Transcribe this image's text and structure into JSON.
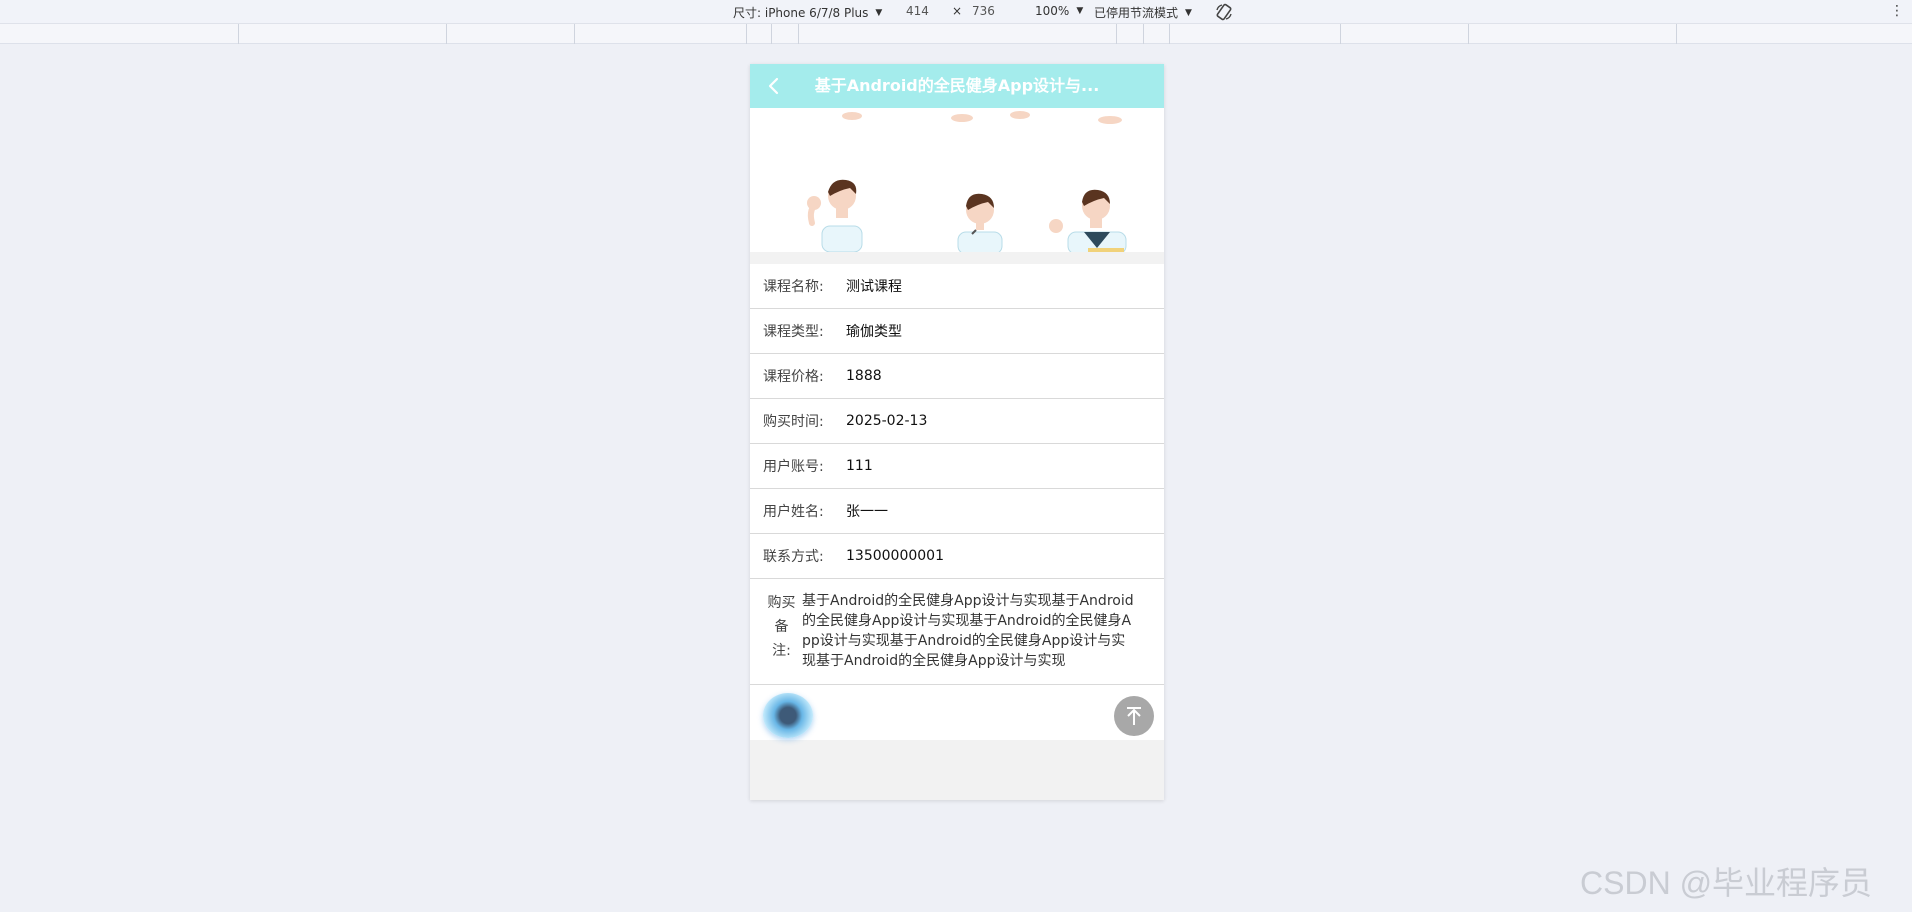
{
  "devtools": {
    "size_label": "尺寸: iPhone 6/7/8 Plus",
    "width_value": "414",
    "times_sign": "×",
    "height_value": "736",
    "zoom_value": "100%",
    "throttle_label": "已停用节流模式",
    "more_icon": "vertical-ellipsis"
  },
  "app": {
    "nav_title": "基于Android的全民健身App设计与...",
    "accent_color": "#a4ecec"
  },
  "details": [
    {
      "label": "课程名称:",
      "value": "测试课程"
    },
    {
      "label": "课程类型:",
      "value": "瑜伽类型"
    },
    {
      "label": "课程价格:",
      "value": "1888"
    },
    {
      "label": "购买时间:",
      "value": "2025-02-13"
    },
    {
      "label": "用户账号:",
      "value": "111"
    },
    {
      "label": "用户姓名:",
      "value": "张一一"
    },
    {
      "label": "联系方式:",
      "value": "13500000001"
    }
  ],
  "remark": {
    "label_lines": [
      "购买",
      "备",
      "注:"
    ],
    "text": "基于Android的全民健身App设计与实现基于Android的全民健身App设计与实现基于Android的全民健身App设计与实现基于Android的全民健身App设计与实现基于Android的全民健身App设计与实现"
  },
  "watermark": "CSDN @毕业程序员"
}
